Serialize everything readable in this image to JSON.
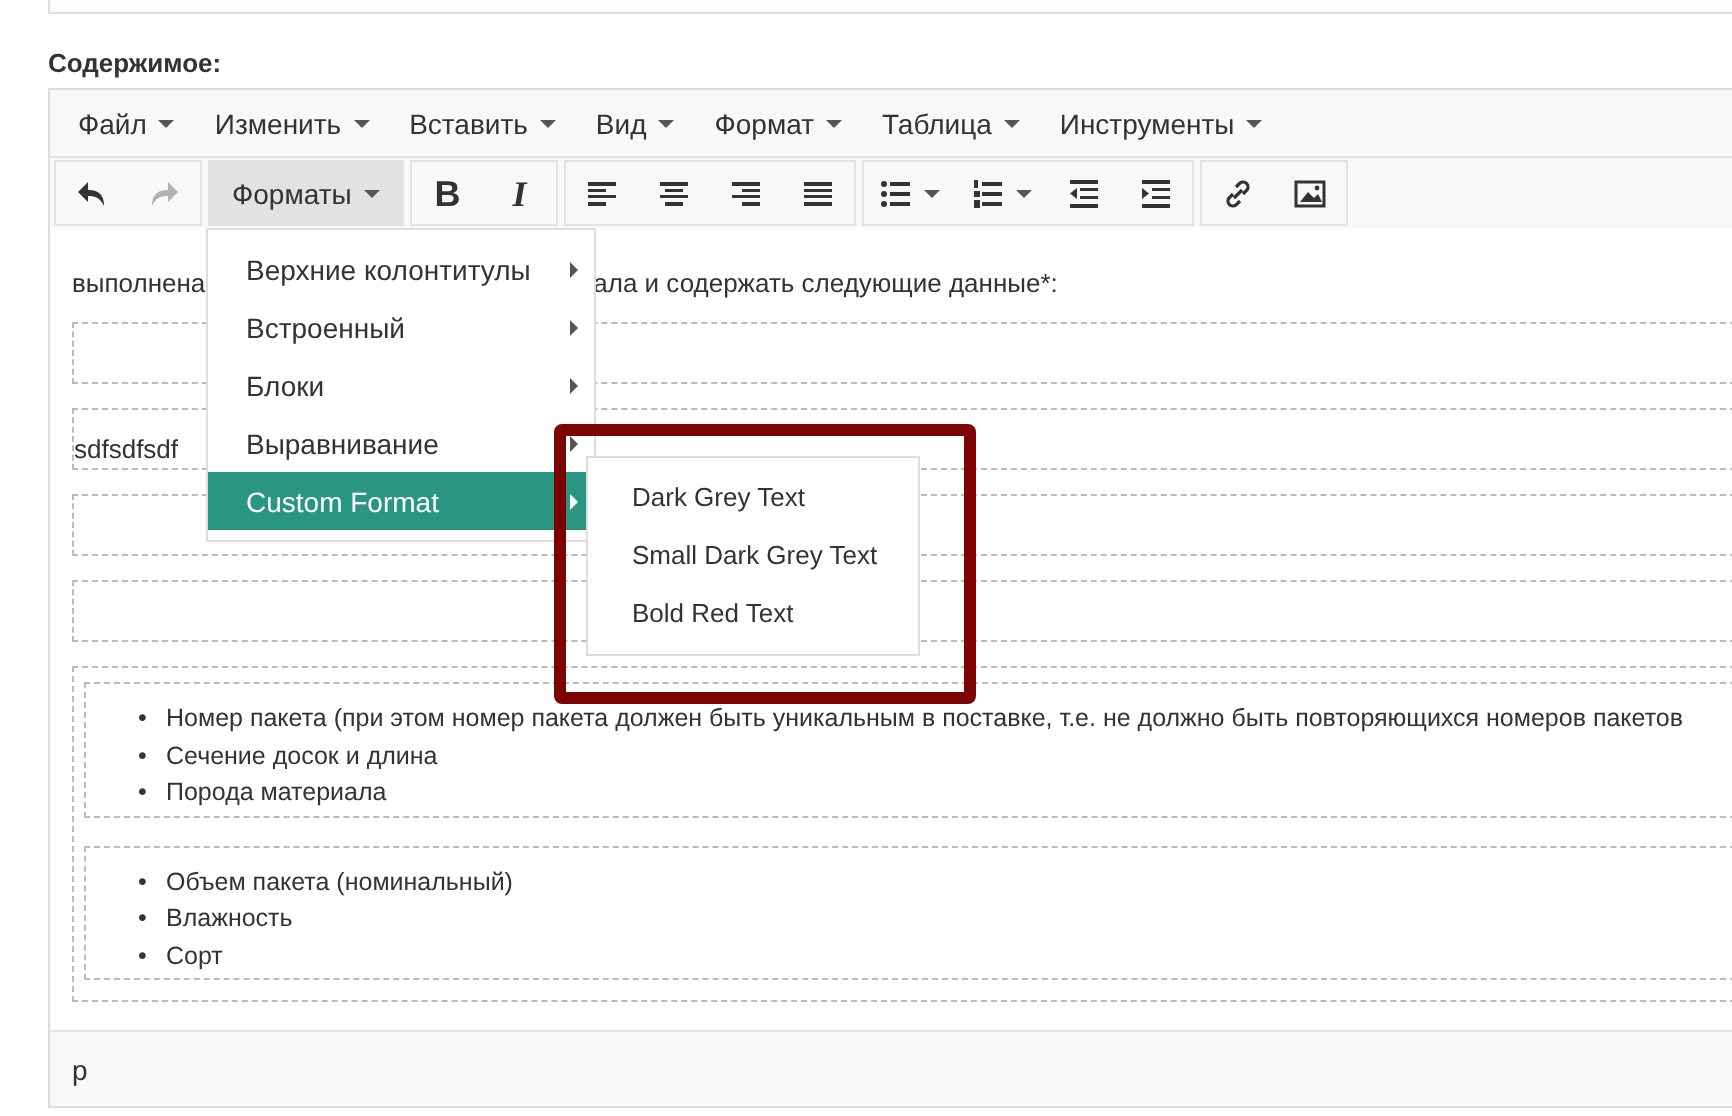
{
  "label": "Содержимое:",
  "menubar": [
    {
      "label": "Файл"
    },
    {
      "label": "Изменить"
    },
    {
      "label": "Вставить"
    },
    {
      "label": "Вид"
    },
    {
      "label": "Формат"
    },
    {
      "label": "Таблица"
    },
    {
      "label": "Инструменты"
    }
  ],
  "toolbar": [
    {
      "buttons": [
        {
          "kind": "undo",
          "disabled": false,
          "selected": false
        },
        {
          "kind": "redo",
          "disabled": true,
          "selected": false
        }
      ]
    },
    {
      "buttons": [
        {
          "kind": "dropdown",
          "label": "Форматы",
          "disabled": false,
          "selected": true
        }
      ]
    },
    {
      "buttons": [
        {
          "kind": "bold",
          "label": "B",
          "disabled": false,
          "selected": false
        },
        {
          "kind": "italic",
          "label": "I",
          "disabled": false,
          "selected": false
        }
      ]
    },
    {
      "buttons": [
        {
          "kind": "align-left",
          "disabled": false,
          "selected": false
        },
        {
          "kind": "align-center",
          "disabled": false,
          "selected": false
        },
        {
          "kind": "align-right",
          "disabled": false,
          "selected": false
        },
        {
          "kind": "align-justify",
          "disabled": false,
          "selected": false
        }
      ]
    },
    {
      "buttons": [
        {
          "kind": "bullist",
          "disabled": false,
          "selected": false
        },
        {
          "kind": "numlist",
          "disabled": false,
          "selected": false
        },
        {
          "kind": "outdent",
          "disabled": false,
          "selected": false
        },
        {
          "kind": "indent",
          "disabled": false,
          "selected": false
        }
      ]
    },
    {
      "buttons": [
        {
          "kind": "link",
          "disabled": false,
          "selected": false
        },
        {
          "kind": "image",
          "disabled": false,
          "selected": false
        }
      ]
    }
  ],
  "content": [
    {
      "kind": "paragraph",
      "parts": [
        "выполнена",
        "ала и содержать следующие данные*:"
      ]
    },
    {
      "kind": "empty_block"
    },
    {
      "kind": "block",
      "text": "sdfsdfsdf"
    },
    {
      "kind": "empty_block"
    },
    {
      "kind": "empty_block"
    },
    {
      "kind": "div",
      "lists": [
        [
          {
            "marker": "•",
            "text": "Номер пакета (при этом номер пакета должен быть уникальным в поставке, т.е. не должно быть повторяющихся номеров пакетов"
          },
          {
            "marker": "•",
            "text": "Сечение досок и длина"
          },
          {
            "marker": "•",
            "text": "Порода материала"
          }
        ],
        [
          {
            "marker": "•",
            "text": "Объем пакета (номинальный)"
          },
          {
            "marker": "•",
            "text": "Влажность"
          },
          {
            "marker": "•",
            "text": "Сорт"
          }
        ]
      ]
    }
  ],
  "formats_menu": [
    {
      "label": "Верхние колонтитулы",
      "has_submenu": true,
      "selected": false
    },
    {
      "label": "Встроенный",
      "has_submenu": true,
      "selected": false
    },
    {
      "label": "Блоки",
      "has_submenu": true,
      "selected": false
    },
    {
      "label": "Выравнивание",
      "has_submenu": true,
      "selected": false
    },
    {
      "label": "Custom Format",
      "has_submenu": true,
      "selected": true
    }
  ],
  "submenu": [
    {
      "label": "Dark Grey Text"
    },
    {
      "label": "Small Dark Grey Text"
    },
    {
      "label": "Bold Red Text"
    }
  ],
  "highlight_frame": true,
  "status_bar": {
    "path": "p"
  }
}
